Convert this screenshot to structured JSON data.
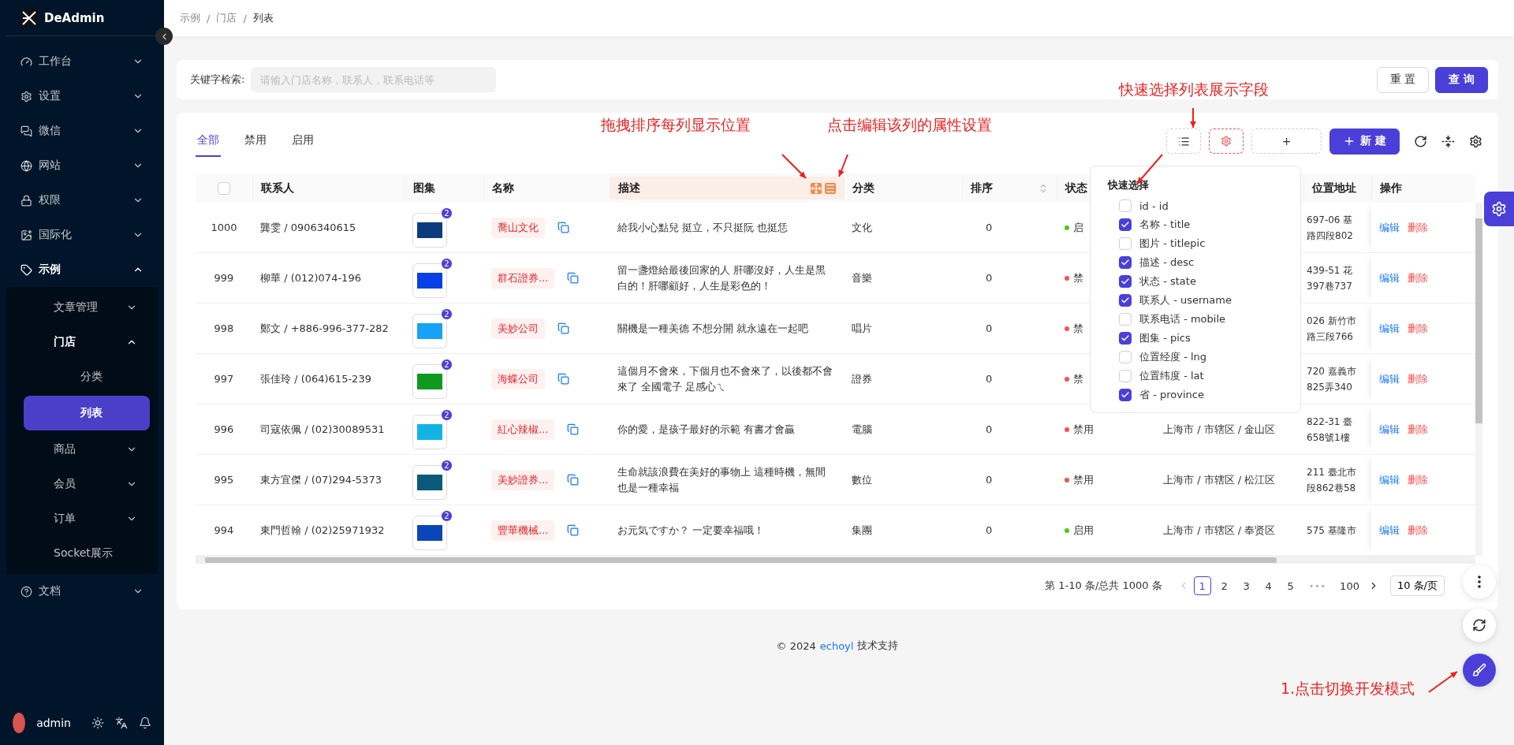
{
  "sidebar": {
    "brand": "DeAdmin",
    "menu": [
      {
        "label": "工作台",
        "expanded": false,
        "selected": false
      },
      {
        "label": "设置",
        "expanded": false,
        "selected": false
      },
      {
        "label": "微信",
        "expanded": false,
        "selected": false
      },
      {
        "label": "网站",
        "expanded": false,
        "selected": false
      },
      {
        "label": "权限",
        "expanded": false,
        "selected": false
      },
      {
        "label": "国际化",
        "expanded": false,
        "selected": false
      },
      {
        "label": "示例",
        "expanded": true,
        "selected": false,
        "children": [
          {
            "label": "文章管理",
            "expanded": false,
            "selected": false
          },
          {
            "label": "门店",
            "expanded": true,
            "selected": false,
            "children": [
              {
                "label": "分类",
                "selected": false
              },
              {
                "label": "列表",
                "selected": true
              }
            ]
          },
          {
            "label": "商品",
            "expanded": false,
            "selected": false
          },
          {
            "label": "会员",
            "expanded": false,
            "selected": false
          },
          {
            "label": "订单",
            "expanded": false,
            "selected": false
          },
          {
            "label": "Socket展示",
            "selected": false
          }
        ]
      },
      {
        "label": "文档",
        "expanded": false,
        "selected": false
      }
    ],
    "user": "admin"
  },
  "breadcrumb": {
    "items": [
      "示例",
      "门店",
      "列表"
    ],
    "separator": "/"
  },
  "search": {
    "label": "关键字检索:",
    "placeholder": "请输入门店名称，联系人，联系电话等",
    "buttons": [
      "重 置",
      "查 询"
    ]
  },
  "tabs": [
    {
      "label": "全部",
      "selected": true
    },
    {
      "label": "禁用",
      "selected": false
    },
    {
      "label": "启用",
      "selected": false
    }
  ],
  "toolbar": {
    "add_column": "+",
    "new_button": "新 建"
  },
  "table": {
    "select_all_checked": false,
    "columns": [
      {
        "label": "联系人"
      },
      {
        "label": "图集"
      },
      {
        "label": "名称"
      },
      {
        "label": "描述",
        "highlighted": true
      },
      {
        "label": "分类"
      },
      {
        "label": "排序",
        "sortable": true
      },
      {
        "label": "状态"
      },
      {
        "label": "位置地址"
      },
      {
        "label": "操作"
      }
    ],
    "rows": [
      {
        "id": "1000",
        "contact": "龔雯 / 0906340615",
        "gallery": {
          "color": "#0b3d7e",
          "count": "2"
        },
        "name": "喬山文化",
        "desc": "給我小心點兒 挺立，不只挺阮 也挺恁",
        "category": "文化",
        "sort": "0",
        "status": "启",
        "status_on": true,
        "address_lines": [
          "697-06 基",
          "路四段802"
        ],
        "actions": [
          "编辑",
          "删除"
        ]
      },
      {
        "id": "999",
        "contact": "柳華 / (012)074-196",
        "gallery": {
          "color": "#0a3fe8",
          "count": "2"
        },
        "name": "群石證券...",
        "desc": "留一盞燈給最後回家的人 肝哪沒好，人生是黑白的！肝哪顧好，人生是彩色的！",
        "category": "音樂",
        "sort": "0",
        "status": "禁",
        "status_on": false,
        "address_lines": [
          "439-51 花",
          "397巷737"
        ],
        "actions": [
          "编辑",
          "删除"
        ]
      },
      {
        "id": "998",
        "contact": "鄭文 / +886-996-377-282",
        "gallery": {
          "color": "#14a3f7",
          "count": "2"
        },
        "name": "美妙公司",
        "desc": "關機是一種美德 不想分開 就永遠在一起吧",
        "category": "唱片",
        "sort": "0",
        "status": "禁",
        "status_on": false,
        "address_lines": [
          "026 新竹市",
          "路三段766"
        ],
        "actions": [
          "编辑",
          "删除"
        ]
      },
      {
        "id": "997",
        "contact": "張佳玲 / (064)615-239",
        "gallery": {
          "color": "#0d9a1d",
          "count": "2"
        },
        "name": "海蝶公司",
        "desc": "這個月不會來，下個月也不會來了，以後都不會來了 全國電子 足感心ㄟ",
        "category": "證券",
        "sort": "0",
        "status": "禁",
        "status_on": false,
        "address_lines": [
          "720 嘉義市",
          "825弄340"
        ],
        "actions": [
          "编辑",
          "删除"
        ]
      },
      {
        "id": "996",
        "contact": "司寇依佩 / (02)30089531",
        "gallery": {
          "color": "#12b3e3",
          "count": "2"
        },
        "name": "紅心辣椒...",
        "desc": "你的愛，是孩子最好的示範 有書才會贏",
        "category": "電腦",
        "sort": "0",
        "status": "禁用",
        "status_on": false,
        "province": "上海市 / 市辖区 / 金山区",
        "address_lines": [
          "822-31 臺",
          "658號1樓"
        ],
        "actions": [
          "编辑",
          "删除"
        ]
      },
      {
        "id": "995",
        "contact": "東方宜傑 / (07)294-5373",
        "gallery": {
          "color": "#0b5a7b",
          "count": "2"
        },
        "name": "美妙證券...",
        "desc": "生命就該浪費在美好的事物上 這種時機，無間也是一種幸福",
        "category": "數位",
        "sort": "0",
        "status": "禁用",
        "status_on": false,
        "province": "上海市 / 市辖区 / 松江区",
        "address_lines": [
          "211 臺北市",
          "段862巷58"
        ],
        "actions": [
          "编辑",
          "删除"
        ]
      },
      {
        "id": "994",
        "contact": "東門哲翰 / (02)25971932",
        "gallery": {
          "color": "#0a46b8",
          "count": "2"
        },
        "name": "豐華機械...",
        "desc": "お元気ですか？ 一定要幸福哦！",
        "category": "集團",
        "sort": "0",
        "status": "启用",
        "status_on": true,
        "province": "上海市 / 市辖区 / 奉贤区",
        "address_lines": [
          "575 基隆市"
        ],
        "actions": [
          "编辑",
          "删除"
        ]
      }
    ]
  },
  "column_picker": {
    "title": "快速选择",
    "options": [
      {
        "label": "id - id",
        "checked": false
      },
      {
        "label": "名称 - title",
        "checked": true
      },
      {
        "label": "图片 - titlepic",
        "checked": false
      },
      {
        "label": "描述 - desc",
        "checked": true
      },
      {
        "label": "状态 - state",
        "checked": true
      },
      {
        "label": "联系人 - username",
        "checked": true
      },
      {
        "label": "联系电话 - mobile",
        "checked": false
      },
      {
        "label": "图集 - pics",
        "checked": true
      },
      {
        "label": "位置经度 - lng",
        "checked": false
      },
      {
        "label": "位置纬度 - lat",
        "checked": false
      },
      {
        "label": "省 - province",
        "checked": true
      }
    ]
  },
  "pagination": {
    "summary": "第 1-10 条/总共 1000 条",
    "prev_disabled": true,
    "pages": [
      {
        "label": "1",
        "kind": "page",
        "selected": true
      },
      {
        "label": "2",
        "kind": "page",
        "selected": false
      },
      {
        "label": "3",
        "kind": "page",
        "selected": false
      },
      {
        "label": "4",
        "kind": "page",
        "selected": false
      },
      {
        "label": "5",
        "kind": "page",
        "selected": false
      },
      {
        "label": "•••",
        "kind": "ellipsis"
      },
      {
        "label": "100",
        "kind": "page",
        "selected": false
      }
    ],
    "page_size": "10 条/页"
  },
  "footer": {
    "copyright": "© 2024",
    "link": "echoyl",
    "text": "技术支持"
  },
  "annotations": [
    {
      "text": "拖拽排序每列显示位置"
    },
    {
      "text": "点击编辑该列的属性设置"
    },
    {
      "text": "快速选择列表展示字段"
    },
    {
      "text": "1.点击切换开发模式"
    }
  ]
}
